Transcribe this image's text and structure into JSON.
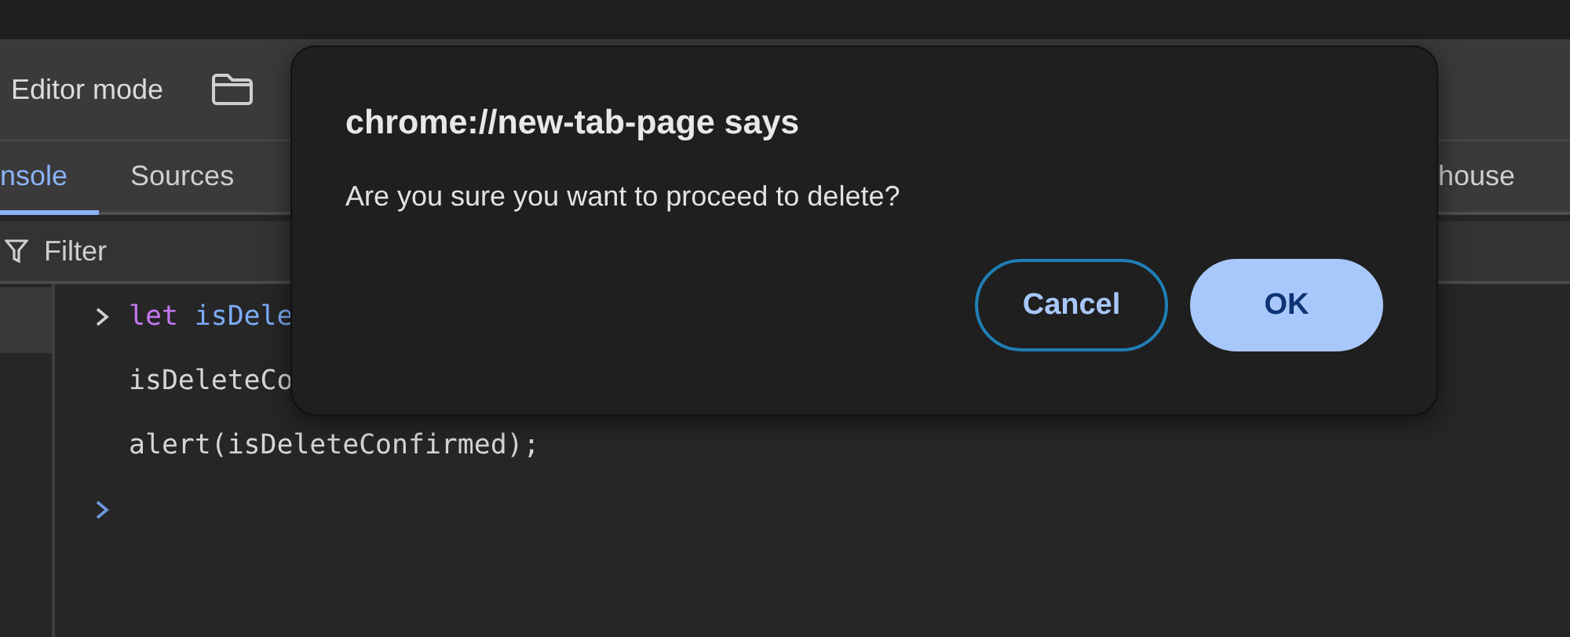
{
  "toolbar": {
    "label": "Editor mode"
  },
  "tabs": [
    {
      "label": "nsole",
      "selected": true
    },
    {
      "label": "Sources",
      "selected": false
    }
  ],
  "trailing_tabs": [
    {
      "label": "house",
      "selected": false
    }
  ],
  "filter": {
    "placeholder": "Filter"
  },
  "sidebar": {
    "items": [
      {
        "selected": true
      }
    ]
  },
  "console": {
    "lines": [
      {
        "prompt": true,
        "tokens": [
          {
            "text": "let",
            "kind": "keyword"
          },
          {
            "text": " isDele",
            "kind": "variable"
          }
        ]
      },
      {
        "prompt": false,
        "tokens": [
          {
            "text": "isDeleteCo",
            "kind": "plain"
          }
        ]
      },
      {
        "prompt": false,
        "tokens": [
          {
            "text": "alert(isDeleteConfirmed);",
            "kind": "plain"
          }
        ]
      }
    ],
    "input_prompt": true
  },
  "dialog": {
    "title": "chrome://new-tab-page says",
    "message": "Are you sure you want to proceed to delete?",
    "buttons": [
      {
        "label": "Cancel",
        "kind": "secondary"
      },
      {
        "label": "OK",
        "kind": "primary"
      }
    ]
  }
}
